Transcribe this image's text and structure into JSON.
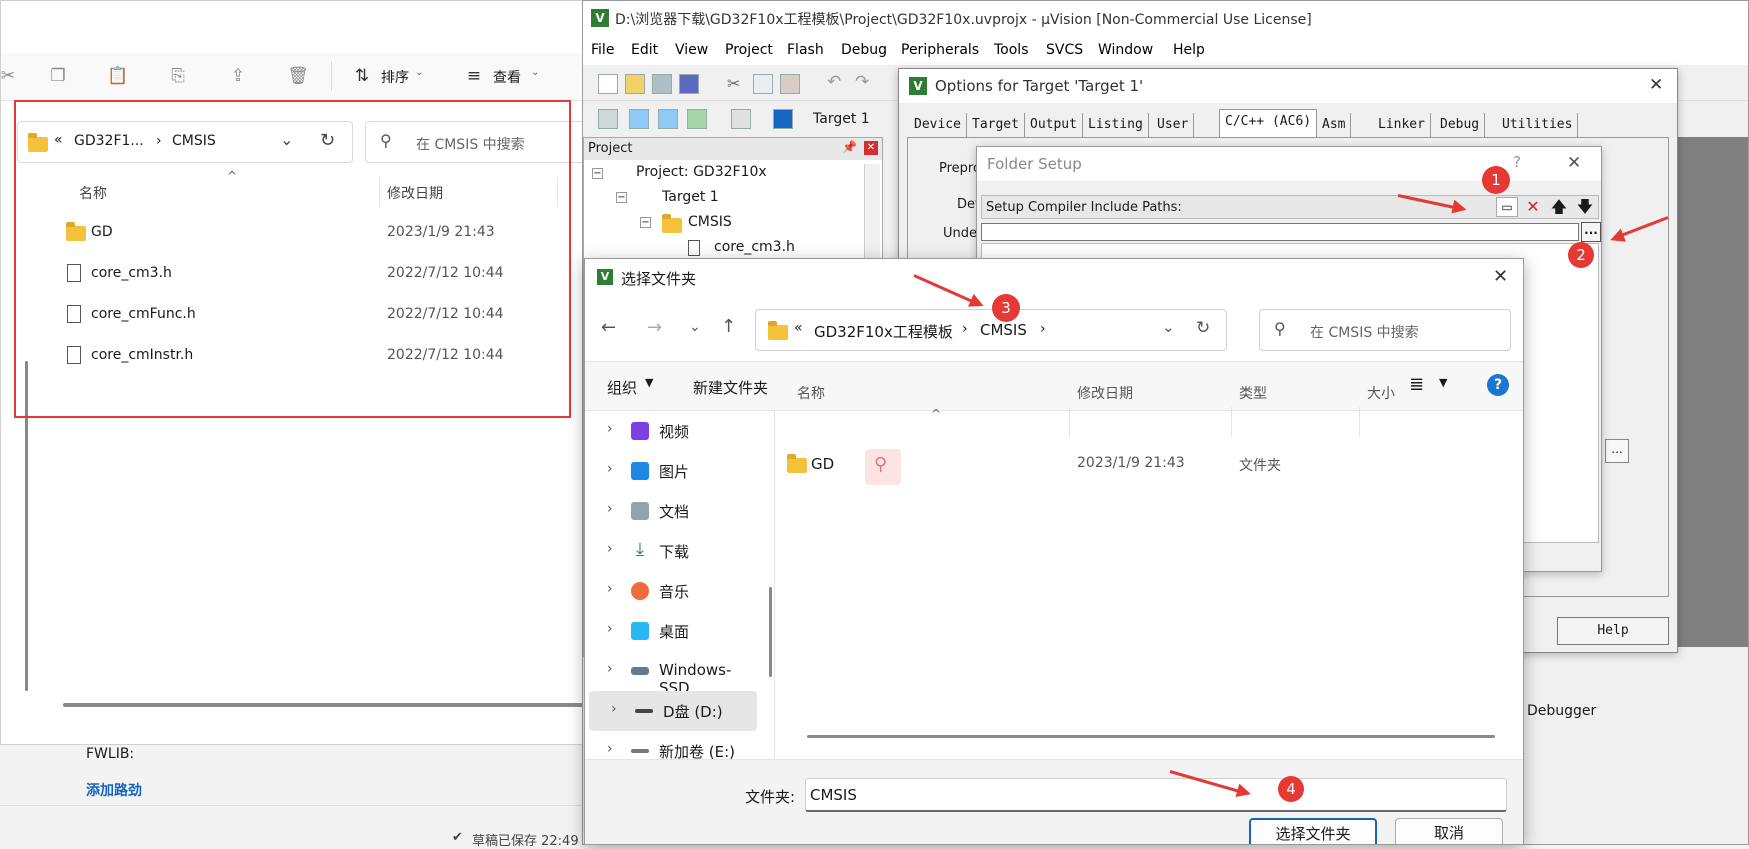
{
  "explorer": {
    "ribbon": {
      "sort_label": "排序",
      "view_label": "查看"
    },
    "address": {
      "prefix": "«",
      "crumb1": "GD32F1...",
      "sep": "›",
      "crumb2": "CMSIS"
    },
    "search_placeholder": "在 CMSIS 中搜索",
    "columns": {
      "name": "名称",
      "modified": "修改日期"
    },
    "files": [
      {
        "name": "GD",
        "date": "2023/1/9 21:43",
        "type": "folder"
      },
      {
        "name": "core_cm3.h",
        "date": "2022/7/12 10:44",
        "type": "file"
      },
      {
        "name": "core_cmFunc.h",
        "date": "2022/7/12 10:44",
        "type": "file"
      },
      {
        "name": "core_cmInstr.h",
        "date": "2022/7/12 10:44",
        "type": "file"
      }
    ]
  },
  "background": {
    "fwlib_label": "FWLIB:",
    "add_path_link": "添加路劲",
    "draft_status": "草稿已保存 22:49"
  },
  "keil": {
    "title": "D:\\浏览器下载\\GD32F10x工程模板\\Project\\GD32F10x.uvprojx - µVision  [Non-Commercial Use License]",
    "menu": [
      "File",
      "Edit",
      "View",
      "Project",
      "Flash",
      "Debug",
      "Peripherals",
      "Tools",
      "SVCS",
      "Window",
      "Help"
    ],
    "target_select": "Target 1",
    "project_panel": {
      "title": "Project",
      "tree": [
        {
          "label": "Project: GD32F10x"
        },
        {
          "label": "Target 1"
        },
        {
          "label": "CMSIS"
        },
        {
          "label": "core_cm3.h"
        }
      ]
    },
    "debugger_label": "Debugger"
  },
  "options": {
    "title": "Options for Target 'Target 1'",
    "tabs": [
      "Device",
      "Target",
      "Output",
      "Listing",
      "User",
      "C/C++ (AC6)",
      "Asm",
      "Linker",
      "Debug",
      "Utilities"
    ],
    "active_tab": "C/C++ (AC6)",
    "group_label": "Prepro",
    "define_label": "Def",
    "undefine_label": "Undef",
    "help_button": "Help"
  },
  "folder_setup": {
    "title": "Folder Setup",
    "help_glyph": "?",
    "header_label": "Setup Compiler Include Paths:",
    "path_value": ""
  },
  "select_folder": {
    "title": "选择文件夹",
    "path": {
      "prefix": "«",
      "crumb1": "GD32F10x工程模板",
      "sep": "›",
      "crumb2": "CMSIS",
      "tail": "›"
    },
    "search_placeholder": "在 CMSIS 中搜索",
    "toolbar": {
      "organize": "组织",
      "new_folder": "新建文件夹"
    },
    "nav": [
      "视频",
      "图片",
      "文档",
      "下载",
      "音乐",
      "桌面",
      "Windows-SSD",
      "D盘 (D:)",
      "新加卷 (E:)"
    ],
    "columns": {
      "name": "名称",
      "modified": "修改日期",
      "type": "类型",
      "size": "大小"
    },
    "files": [
      {
        "name": "GD",
        "date": "2023/1/9 21:43",
        "type": "文件夹"
      }
    ],
    "folder_label": "文件夹:",
    "folder_value": "CMSIS",
    "select_button": "选择文件夹",
    "cancel_button": "取消"
  },
  "annotations": [
    "1",
    "2",
    "3",
    "4"
  ]
}
